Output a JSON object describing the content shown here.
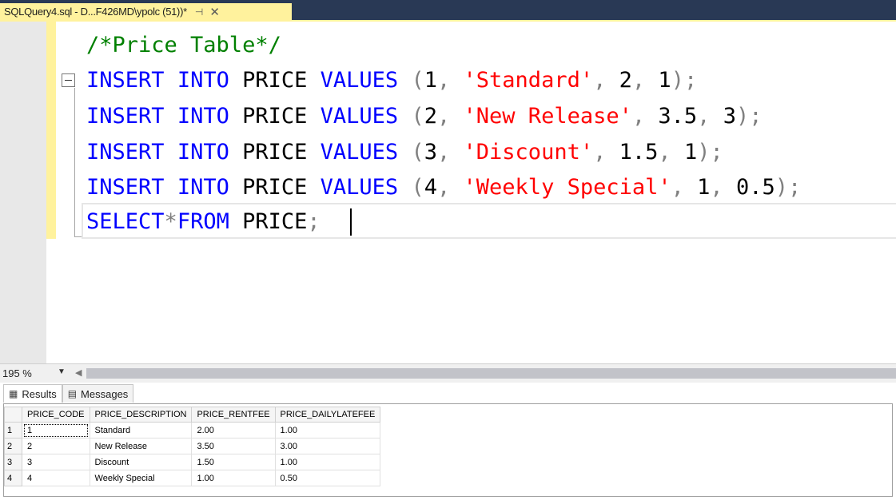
{
  "tab": {
    "title": "SQLQuery4.sql - D...F426MD\\ypolc (51))*",
    "pin_glyph": "⊣",
    "close_glyph": "✕"
  },
  "editor": {
    "comment": "/*Price Table*/",
    "lines": [
      {
        "kw1": "INSERT",
        "kw2": "INTO",
        "table": "PRICE",
        "kw3": "VALUES",
        "open": "(",
        "id": "1",
        "c1": ",",
        "desc": "'Standard'",
        "c2": ",",
        "fee": "2",
        "c3": ",",
        "late": "1",
        "close": ");"
      },
      {
        "kw1": "INSERT",
        "kw2": "INTO",
        "table": "PRICE",
        "kw3": "VALUES",
        "open": "(",
        "id": "2",
        "c1": ",",
        "desc": "'New Release'",
        "c2": ",",
        "fee": "3.5",
        "c3": ",",
        "late": "3",
        "close": ");"
      },
      {
        "kw1": "INSERT",
        "kw2": "INTO",
        "table": "PRICE",
        "kw3": "VALUES",
        "open": "(",
        "id": "3",
        "c1": ",",
        "desc": "'Discount'",
        "c2": ",",
        "fee": "1.5",
        "c3": ",",
        "late": "1",
        "close": ");"
      },
      {
        "kw1": "INSERT",
        "kw2": "INTO",
        "table": "PRICE",
        "kw3": "VALUES",
        "open": "(",
        "id": "4",
        "c1": ",",
        "desc": "'Weekly Special'",
        "c2": ",",
        "fee": "1",
        "c3": ",",
        "late": "0.5",
        "close": ");"
      }
    ],
    "select": {
      "kw1": "SELECT",
      "star": "*",
      "kw2": "FROM",
      "table": "PRICE",
      "semi": ";"
    }
  },
  "zoom": {
    "value": "195 %"
  },
  "results": {
    "tabs": [
      {
        "label": "Results",
        "icon": "grid-icon"
      },
      {
        "label": "Messages",
        "icon": "messages-icon"
      }
    ],
    "columns": [
      "PRICE_CODE",
      "PRICE_DESCRIPTION",
      "PRICE_RENTFEE",
      "PRICE_DAILYLATEFEE"
    ],
    "rows": [
      {
        "num": "1",
        "cells": [
          "1",
          "Standard",
          "2.00",
          "1.00"
        ]
      },
      {
        "num": "2",
        "cells": [
          "2",
          "New Release",
          "3.50",
          "3.00"
        ]
      },
      {
        "num": "3",
        "cells": [
          "3",
          "Discount",
          "1.50",
          "1.00"
        ]
      },
      {
        "num": "4",
        "cells": [
          "4",
          "Weekly Special",
          "1.00",
          "0.50"
        ]
      }
    ]
  },
  "colors": {
    "tabstrip": "#293955",
    "tab_active": "#fff29d",
    "keyword": "#0000ff",
    "string": "#ff0000",
    "comment": "#008000",
    "operator": "#808080"
  }
}
